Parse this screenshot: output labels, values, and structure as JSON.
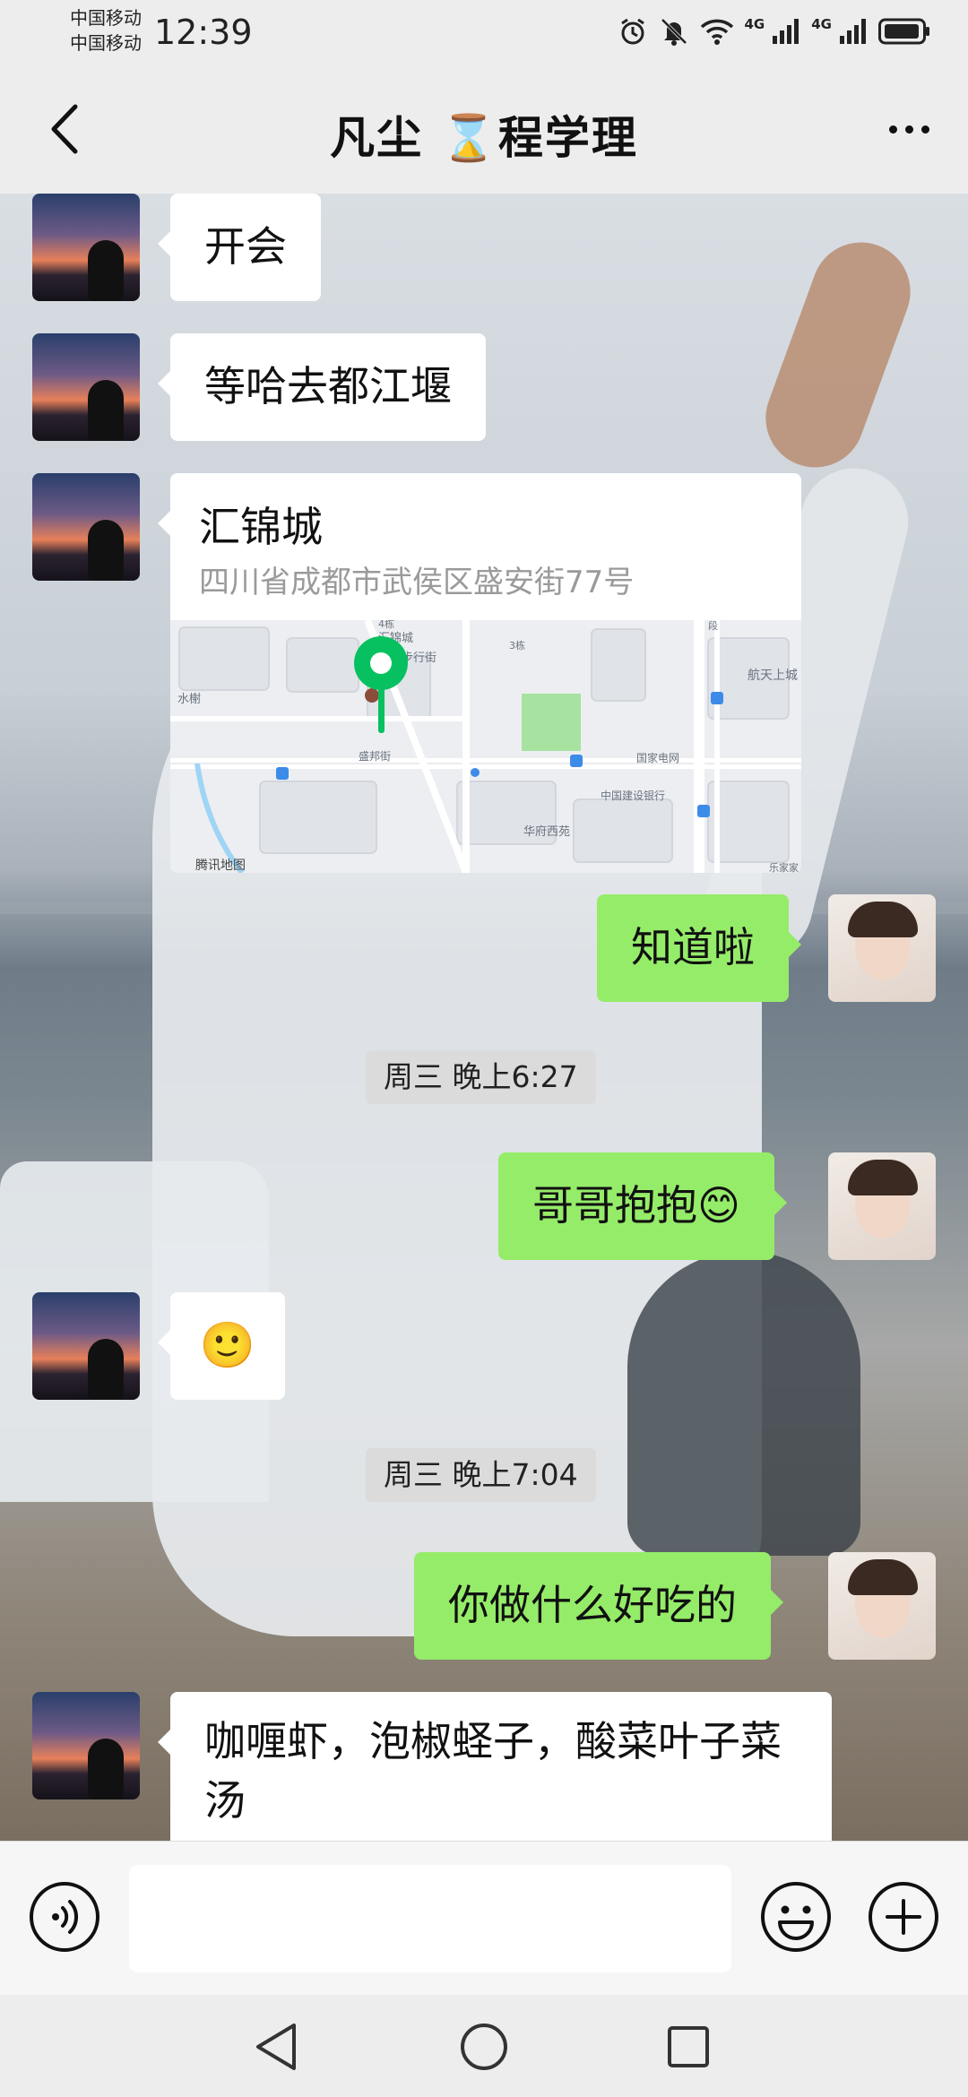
{
  "status_bar": {
    "carrier_1": "中国移动",
    "carrier_2": "中国移动",
    "time": "12:39",
    "net_1": "4G",
    "net_2": "4G",
    "icons": [
      "alarm-icon",
      "mute-icon",
      "wifi-icon",
      "signal-icon",
      "signal-icon",
      "battery-icon"
    ]
  },
  "header": {
    "title": "凡尘 ⌛程学理",
    "back_icon": "chevron-left-icon",
    "more_icon": "more-dots-icon"
  },
  "messages": [
    {
      "side": "left",
      "type": "text",
      "text": "开会"
    },
    {
      "side": "left",
      "type": "text",
      "text": "等哈去都江堰"
    },
    {
      "side": "left",
      "type": "location",
      "name": "汇锦城",
      "address": "四川省成都市武侯区盛安街77号",
      "map_labels": {
        "street_1": "汇锦步行街",
        "street_2": "汇锦城",
        "area_1": "水榭",
        "road_1": "盛邦街",
        "poi_1": "国家电网",
        "poi_2": "中国建设银行",
        "area_2": "华府西苑",
        "area_3": "航天上城",
        "provider": "腾讯地图",
        "block_1": "4栋",
        "block_2": "3栋",
        "block_3": "段",
        "corner": "乐家家"
      }
    },
    {
      "side": "right",
      "type": "text",
      "text": "知道啦"
    },
    {
      "type": "timestamp",
      "text": "周三 晚上6:27"
    },
    {
      "side": "right",
      "type": "text",
      "text": "哥哥抱抱😊"
    },
    {
      "side": "left",
      "type": "emoji",
      "text": "🙂"
    },
    {
      "type": "timestamp",
      "text": "周三 晚上7:04"
    },
    {
      "side": "right",
      "type": "text",
      "text": "你做什么好吃的"
    },
    {
      "side": "left",
      "type": "text",
      "text": "咖喱虾，泡椒蛏子，酸菜叶子菜汤"
    }
  ],
  "input_bar": {
    "placeholder": "",
    "voice_icon": "voice-icon",
    "emoji_icon": "emoji-icon",
    "plus_icon": "plus-icon"
  },
  "nav_bar": {
    "icons": [
      "back-triangle-icon",
      "home-circle-icon",
      "recents-square-icon"
    ]
  },
  "colors": {
    "bubble_self": "#95ec69",
    "bubble_other": "#ffffff",
    "map_pin": "#07c160"
  }
}
